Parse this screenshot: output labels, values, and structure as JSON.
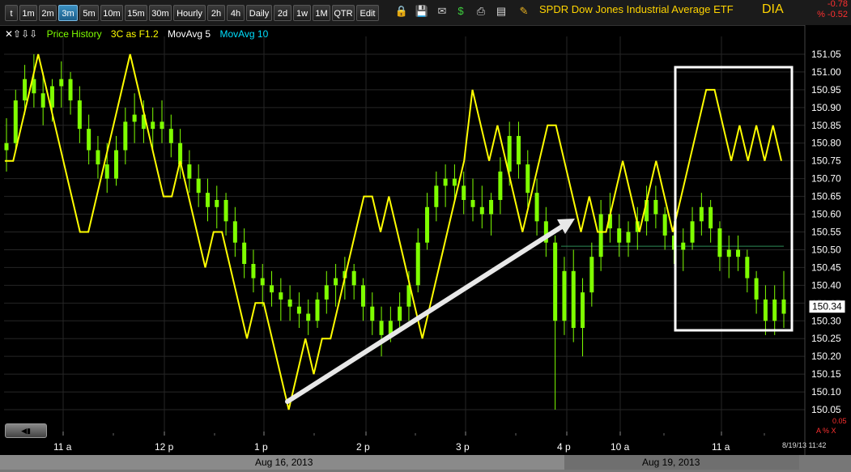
{
  "toolbar": {
    "buttons": [
      "t",
      "1m",
      "2m",
      "3m",
      "5m",
      "10m",
      "15m",
      "30m",
      "Hourly",
      "2h",
      "4h",
      "Daily",
      "2d",
      "1w",
      "1M",
      "QTR",
      "Edit"
    ],
    "active": "3m",
    "symbol_name": "SPDR Dow Jones Industrial Average ETF",
    "symbol": "DIA",
    "change": "-0.78",
    "change_pct": "% -0.52"
  },
  "legend": {
    "arrows": "✕⇧⇩⇩",
    "price_history": "Price History",
    "three_c": "3C as F1.2",
    "movavg5": "MovAvg 5",
    "movavg10": "MovAvg 10"
  },
  "colors": {
    "candle": "#7fff00",
    "three_c": "#ffff00",
    "legend_price": "#7fff00",
    "legend_3c": "#ffff00",
    "legend_ma5": "#ffffff",
    "legend_ma10": "#00e0ff",
    "grid": "#262626",
    "accent": "#ffffff"
  },
  "footer": {
    "date1": "Aug 16, 2013",
    "date2": "Aug 19, 2013",
    "timestamp": "8/19/13 11:42",
    "corner_value": "0.05",
    "corner_ctrl": "A % X"
  },
  "chart_data": {
    "type": "candlestick",
    "y_axis_ticks": [
      "151.05",
      "151.00",
      "150.95",
      "150.90",
      "150.85",
      "150.80",
      "150.75",
      "150.70",
      "150.65",
      "150.60",
      "150.55",
      "150.50",
      "150.45",
      "150.40",
      "150.35",
      "150.30",
      "150.25",
      "150.20",
      "150.15",
      "150.10",
      "150.05"
    ],
    "ylim": [
      150.0,
      151.1
    ],
    "x_tick_labels": [
      "11 a",
      "12 p",
      "1 p",
      "2 p",
      "3 p",
      "4 p",
      "10 a",
      "11 a"
    ],
    "price_now": "150.34",
    "reference_level": 150.51,
    "grid": true,
    "candles": [
      [
        150.78,
        150.87,
        150.72,
        150.8
      ],
      [
        150.8,
        150.95,
        150.78,
        150.92
      ],
      [
        150.92,
        151.02,
        150.88,
        150.98
      ],
      [
        150.98,
        151.05,
        150.9,
        150.94
      ],
      [
        150.94,
        151.0,
        150.85,
        150.9
      ],
      [
        150.9,
        150.98,
        150.86,
        150.96
      ],
      [
        150.96,
        151.03,
        150.9,
        150.98
      ],
      [
        150.98,
        151.0,
        150.88,
        150.92
      ],
      [
        150.92,
        150.96,
        150.8,
        150.84
      ],
      [
        150.84,
        150.88,
        150.74,
        150.78
      ],
      [
        150.78,
        150.82,
        150.7,
        150.74
      ],
      [
        150.74,
        150.8,
        150.66,
        150.7
      ],
      [
        150.7,
        150.82,
        150.68,
        150.78
      ],
      [
        150.78,
        150.9,
        150.74,
        150.86
      ],
      [
        150.86,
        150.94,
        150.8,
        150.88
      ],
      [
        150.88,
        150.92,
        150.8,
        150.84
      ],
      [
        150.84,
        150.9,
        150.78,
        150.86
      ],
      [
        150.86,
        150.92,
        150.8,
        150.84
      ],
      [
        150.84,
        150.88,
        150.76,
        150.8
      ],
      [
        150.8,
        150.84,
        150.7,
        150.74
      ],
      [
        150.74,
        150.78,
        150.66,
        150.7
      ],
      [
        150.7,
        150.74,
        150.62,
        150.66
      ],
      [
        150.66,
        150.7,
        150.58,
        150.62
      ],
      [
        150.62,
        150.68,
        150.56,
        150.64
      ],
      [
        150.64,
        150.66,
        150.54,
        150.58
      ],
      [
        150.58,
        150.62,
        150.48,
        150.52
      ],
      [
        150.52,
        150.56,
        150.42,
        150.46
      ],
      [
        150.46,
        150.5,
        150.38,
        150.42
      ],
      [
        150.42,
        150.46,
        150.34,
        150.4
      ],
      [
        150.4,
        150.44,
        150.34,
        150.38
      ],
      [
        150.38,
        150.42,
        150.3,
        150.36
      ],
      [
        150.36,
        150.4,
        150.3,
        150.34
      ],
      [
        150.34,
        150.38,
        150.28,
        150.32
      ],
      [
        150.32,
        150.36,
        150.26,
        150.3
      ],
      [
        150.3,
        150.38,
        150.28,
        150.36
      ],
      [
        150.36,
        150.44,
        150.32,
        150.4
      ],
      [
        150.4,
        150.46,
        150.34,
        150.42
      ],
      [
        150.42,
        150.48,
        150.36,
        150.44
      ],
      [
        150.44,
        150.46,
        150.36,
        150.4
      ],
      [
        150.4,
        150.42,
        150.3,
        150.34
      ],
      [
        150.34,
        150.38,
        150.26,
        150.3
      ],
      [
        150.3,
        150.34,
        150.2,
        150.26
      ],
      [
        150.26,
        150.34,
        150.24,
        150.3
      ],
      [
        150.3,
        150.38,
        150.28,
        150.34
      ],
      [
        150.34,
        150.44,
        150.3,
        150.4
      ],
      [
        150.4,
        150.56,
        150.38,
        150.52
      ],
      [
        150.52,
        150.66,
        150.5,
        150.62
      ],
      [
        150.62,
        150.72,
        150.58,
        150.68
      ],
      [
        150.68,
        150.74,
        150.62,
        150.7
      ],
      [
        150.7,
        150.74,
        150.64,
        150.68
      ],
      [
        150.68,
        150.72,
        150.6,
        150.64
      ],
      [
        150.64,
        150.7,
        150.58,
        150.62
      ],
      [
        150.62,
        150.68,
        150.56,
        150.6
      ],
      [
        150.6,
        150.66,
        150.54,
        150.64
      ],
      [
        150.64,
        150.76,
        150.6,
        150.72
      ],
      [
        150.72,
        150.86,
        150.68,
        150.82
      ],
      [
        150.82,
        150.86,
        150.7,
        150.74
      ],
      [
        150.74,
        150.78,
        150.62,
        150.66
      ],
      [
        150.66,
        150.7,
        150.54,
        150.58
      ],
      [
        150.58,
        150.62,
        150.48,
        150.52
      ],
      [
        150.52,
        150.54,
        150.05,
        150.3
      ],
      [
        150.3,
        150.48,
        150.26,
        150.44
      ],
      [
        150.44,
        150.5,
        150.24,
        150.28
      ],
      [
        150.28,
        150.42,
        150.2,
        150.38
      ],
      [
        150.38,
        150.52,
        150.34,
        150.48
      ],
      [
        150.48,
        150.64,
        150.44,
        150.6
      ],
      [
        150.6,
        150.66,
        150.52,
        150.56
      ],
      [
        150.56,
        150.6,
        150.48,
        150.52
      ],
      [
        150.52,
        150.58,
        150.48,
        150.55
      ],
      [
        150.55,
        150.62,
        150.5,
        150.58
      ],
      [
        150.58,
        150.68,
        150.54,
        150.64
      ],
      [
        150.64,
        150.68,
        150.56,
        150.6
      ],
      [
        150.6,
        150.62,
        150.5,
        150.54
      ],
      [
        150.54,
        150.58,
        150.46,
        150.5
      ],
      [
        150.5,
        150.56,
        150.44,
        150.52
      ],
      [
        150.52,
        150.62,
        150.5,
        150.58
      ],
      [
        150.58,
        150.66,
        150.54,
        150.62
      ],
      [
        150.62,
        150.64,
        150.52,
        150.56
      ],
      [
        150.56,
        150.58,
        150.44,
        150.48
      ],
      [
        150.48,
        150.54,
        150.42,
        150.5
      ],
      [
        150.5,
        150.54,
        150.44,
        150.48
      ],
      [
        150.48,
        150.5,
        150.38,
        150.42
      ],
      [
        150.42,
        150.44,
        150.32,
        150.36
      ],
      [
        150.36,
        150.4,
        150.26,
        150.3
      ],
      [
        150.3,
        150.4,
        150.26,
        150.36
      ],
      [
        150.36,
        150.44,
        150.28,
        150.32
      ]
    ],
    "three_c_line": [
      150.75,
      150.75,
      150.85,
      150.95,
      151.05,
      150.95,
      150.85,
      150.75,
      150.65,
      150.55,
      150.55,
      150.65,
      150.75,
      150.85,
      150.95,
      151.05,
      150.95,
      150.85,
      150.75,
      150.65,
      150.65,
      150.75,
      150.65,
      150.55,
      150.45,
      150.55,
      150.55,
      150.45,
      150.35,
      150.25,
      150.35,
      150.35,
      150.25,
      150.15,
      150.05,
      150.15,
      150.25,
      150.15,
      150.25,
      150.25,
      150.35,
      150.45,
      150.55,
      150.65,
      150.65,
      150.55,
      150.65,
      150.55,
      150.45,
      150.35,
      150.25,
      150.35,
      150.45,
      150.55,
      150.65,
      150.75,
      150.95,
      150.85,
      150.75,
      150.85,
      150.75,
      150.65,
      150.55,
      150.65,
      150.75,
      150.85,
      150.85,
      150.75,
      150.65,
      150.55,
      150.65,
      150.55,
      150.55,
      150.65,
      150.75,
      150.65,
      150.55,
      150.65,
      150.75,
      150.65,
      150.55,
      150.65,
      150.75,
      150.85,
      150.95,
      150.95,
      150.85,
      150.75,
      150.85,
      150.75,
      150.85,
      150.75,
      150.85,
      150.75
    ],
    "annotations": [
      "white trend arrow rising from Aug 16 1 p low to Aug 16 4 p",
      "white rectangle box around Aug 19 11 a price/3C divergence"
    ]
  }
}
